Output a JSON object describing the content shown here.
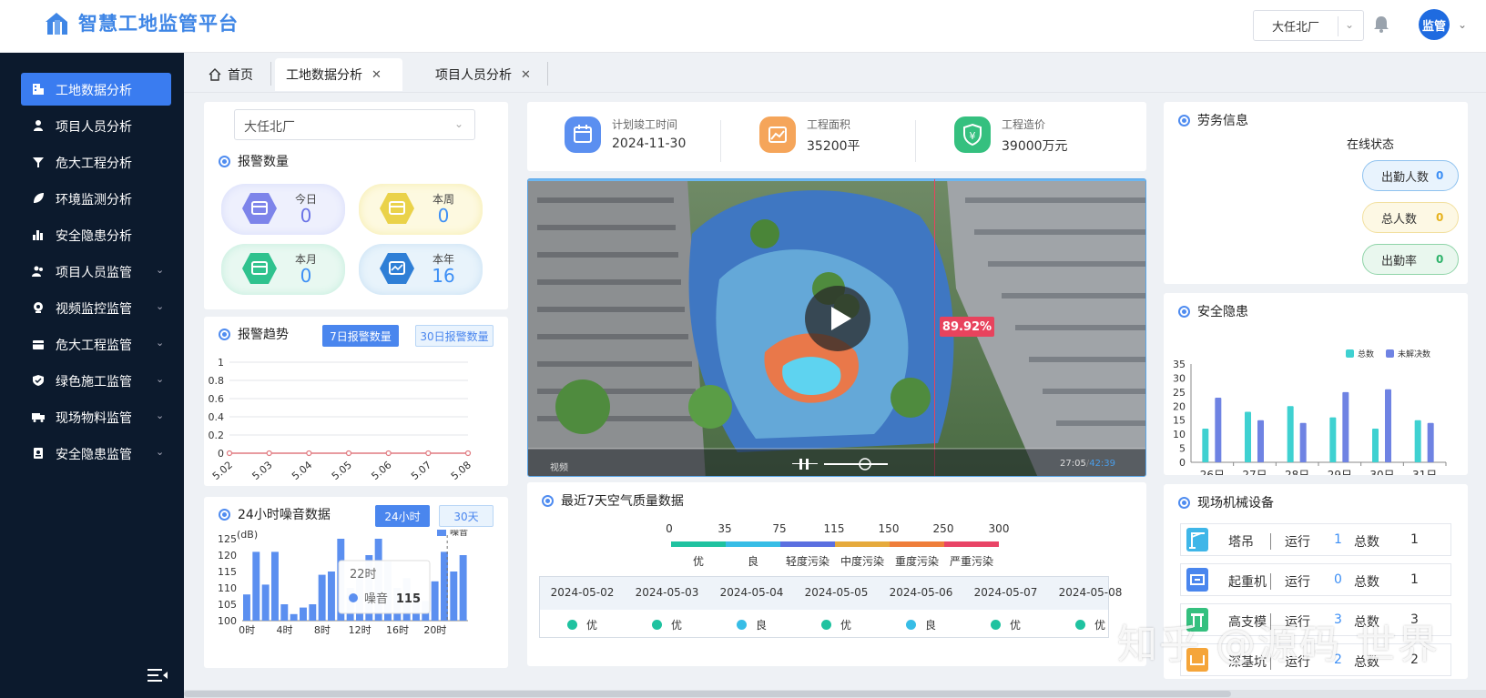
{
  "header": {
    "title": "智慧工地监管平台",
    "site_select": "大任北厂",
    "avatar_text": "监管"
  },
  "sidebar": {
    "items": [
      {
        "label": "工地数据分析",
        "active": true,
        "icon": "building-icon"
      },
      {
        "label": "项目人员分析",
        "icon": "person-icon"
      },
      {
        "label": "危大工程分析",
        "icon": "filter-icon"
      },
      {
        "label": "环境监测分析",
        "icon": "leaf-icon"
      },
      {
        "label": "安全隐患分析",
        "icon": "bar-chart-icon"
      },
      {
        "label": "项目人员监管",
        "expandable": true,
        "icon": "people-icon"
      },
      {
        "label": "视频监控监管",
        "expandable": true,
        "icon": "camera-icon"
      },
      {
        "label": "危大工程监管",
        "expandable": true,
        "icon": "box-icon"
      },
      {
        "label": "绿色施工监管",
        "expandable": true,
        "icon": "shield-icon"
      },
      {
        "label": "现场物料监管",
        "expandable": true,
        "icon": "truck-icon"
      },
      {
        "label": "安全隐患监管",
        "expandable": true,
        "icon": "document-icon"
      }
    ]
  },
  "tabs": [
    {
      "label": "首页",
      "icon": "home-icon"
    },
    {
      "label": "工地数据分析",
      "active": true,
      "closable": true
    },
    {
      "label": "项目人员分析",
      "closable": true
    }
  ],
  "left": {
    "site_select": "大任北厂",
    "alarm_count": {
      "title": "报警数量",
      "items": [
        {
          "label": "今日",
          "value": "0",
          "color": "#6a73e6"
        },
        {
          "label": "本周",
          "value": "0",
          "color": "#e6c326"
        },
        {
          "label": "本月",
          "value": "0",
          "color": "#27c08f"
        },
        {
          "label": "本年",
          "value": "16",
          "color": "#2f7fd6"
        }
      ]
    },
    "alarm_trend": {
      "title": "报警趋势",
      "btn_7": "7日报警数量",
      "btn_30": "30日报警数量"
    },
    "noise": {
      "title": "24小时噪音数据",
      "btn_24h": "24小时",
      "btn_30d": "30天",
      "unit": "(dB)",
      "legend": "噪音",
      "tooltip_title": "22时",
      "tooltip_label": "噪音",
      "tooltip_value": "115"
    }
  },
  "project_info": [
    {
      "label": "计划竣工时间",
      "value": "2024-11-30",
      "color": "#5b8ff0",
      "icon": "calendar-icon"
    },
    {
      "label": "工程面积",
      "value": "35200平",
      "color": "#f5a55a",
      "icon": "area-chart-icon"
    },
    {
      "label": "工程造价",
      "value": "39000万元",
      "color": "#35c07f",
      "icon": "yuan-shield-icon"
    }
  ],
  "video": {
    "badge": "89.92%",
    "source": "视频",
    "time_current": "27:05",
    "time_total": "42:39"
  },
  "air_quality": {
    "title": "最近7天空气质量数据",
    "scale_numbers": [
      "0",
      "35",
      "75",
      "115",
      "150",
      "250",
      "300"
    ],
    "levels": [
      {
        "label": "优",
        "color": "#1fc2a0"
      },
      {
        "label": "良",
        "color": "#37bde6"
      },
      {
        "label": "轻度污染",
        "color": "#5b6fe0"
      },
      {
        "label": "中度污染",
        "color": "#e6aa3c"
      },
      {
        "label": "重度污染",
        "color": "#ef7e3a"
      },
      {
        "label": "严重污染",
        "color": "#e94466"
      }
    ],
    "dates": [
      "2024-05-02",
      "2024-05-03",
      "2024-05-04",
      "2024-05-05",
      "2024-05-06",
      "2024-05-07",
      "2024-05-08"
    ],
    "statuses": [
      "优",
      "优",
      "良",
      "优",
      "良",
      "优",
      "优"
    ],
    "status_colors": [
      "#1fc2a0",
      "#1fc2a0",
      "#37bde6",
      "#1fc2a0",
      "#37bde6",
      "#1fc2a0",
      "#1fc2a0"
    ]
  },
  "labor": {
    "title": "劳务信息",
    "subtitle": "在线状态",
    "items": [
      {
        "label": "出勤人数",
        "value": "0"
      },
      {
        "label": "总人数",
        "value": "0"
      },
      {
        "label": "出勤率",
        "value": "0"
      }
    ]
  },
  "hazard": {
    "title": "安全隐患"
  },
  "machinery": {
    "title": "现场机械设备",
    "items": [
      {
        "name": "塔吊",
        "run_label": "运行",
        "run": "1",
        "total_label": "总数",
        "total": "1",
        "icon": "tower-crane-icon",
        "color": "#3fb6e8"
      },
      {
        "name": "起重机",
        "run_label": "运行",
        "run": "0",
        "total_label": "总数",
        "total": "1",
        "icon": "crane-icon",
        "color": "#4a86ee"
      },
      {
        "name": "高支模",
        "run_label": "运行",
        "run": "3",
        "total_label": "总数",
        "total": "3",
        "icon": "formwork-icon",
        "color": "#35c07f"
      },
      {
        "name": "深基坑",
        "run_label": "运行",
        "run": "2",
        "total_label": "总数",
        "total": "2",
        "icon": "pit-icon",
        "color": "#f5a53a"
      }
    ]
  },
  "watermark": "知乎 @源码 世界",
  "chart_data": [
    {
      "type": "line",
      "title": "报警趋势",
      "categories": [
        "5.02",
        "5.03",
        "5.04",
        "5.05",
        "5.06",
        "5.07",
        "5.08"
      ],
      "values": [
        0,
        0,
        0,
        0,
        0,
        0,
        0
      ],
      "ylim": [
        0,
        1
      ],
      "yticks": [
        "0",
        "0.2",
        "0.4",
        "0.6",
        "0.8",
        "1"
      ],
      "color": "#e07a80",
      "grid": true
    },
    {
      "type": "bar",
      "title": "24小时噪音数据",
      "ylabel": "(dB)",
      "ylim": [
        100,
        125
      ],
      "yticks": [
        "100",
        "105",
        "110",
        "115",
        "120",
        "125"
      ],
      "xticks": [
        "0时",
        "4时",
        "8时",
        "12时",
        "16时",
        "20时"
      ],
      "series": [
        {
          "name": "噪音",
          "values": [
            108,
            121,
            111,
            121,
            105,
            102,
            104,
            105,
            114,
            115,
            125,
            110,
            114,
            120,
            125,
            118,
            110,
            113,
            108,
            106,
            112,
            121,
            115,
            120
          ]
        }
      ],
      "color": "#5b8ff0",
      "legend": "top-right"
    },
    {
      "type": "bar",
      "title": "安全隐患",
      "categories": [
        "26日",
        "27日",
        "28日",
        "29日",
        "30日",
        "31日"
      ],
      "ylim": [
        0,
        35
      ],
      "yticks": [
        "0",
        "5",
        "10",
        "15",
        "20",
        "25",
        "30",
        "35"
      ],
      "series": [
        {
          "name": "总数",
          "values": [
            12,
            18,
            20,
            16,
            12,
            15
          ],
          "color": "#3fd1d1"
        },
        {
          "name": "未解决数",
          "values": [
            23,
            15,
            14,
            25,
            26,
            14
          ],
          "color": "#6f83e3"
        }
      ],
      "legend": "top-right"
    }
  ]
}
